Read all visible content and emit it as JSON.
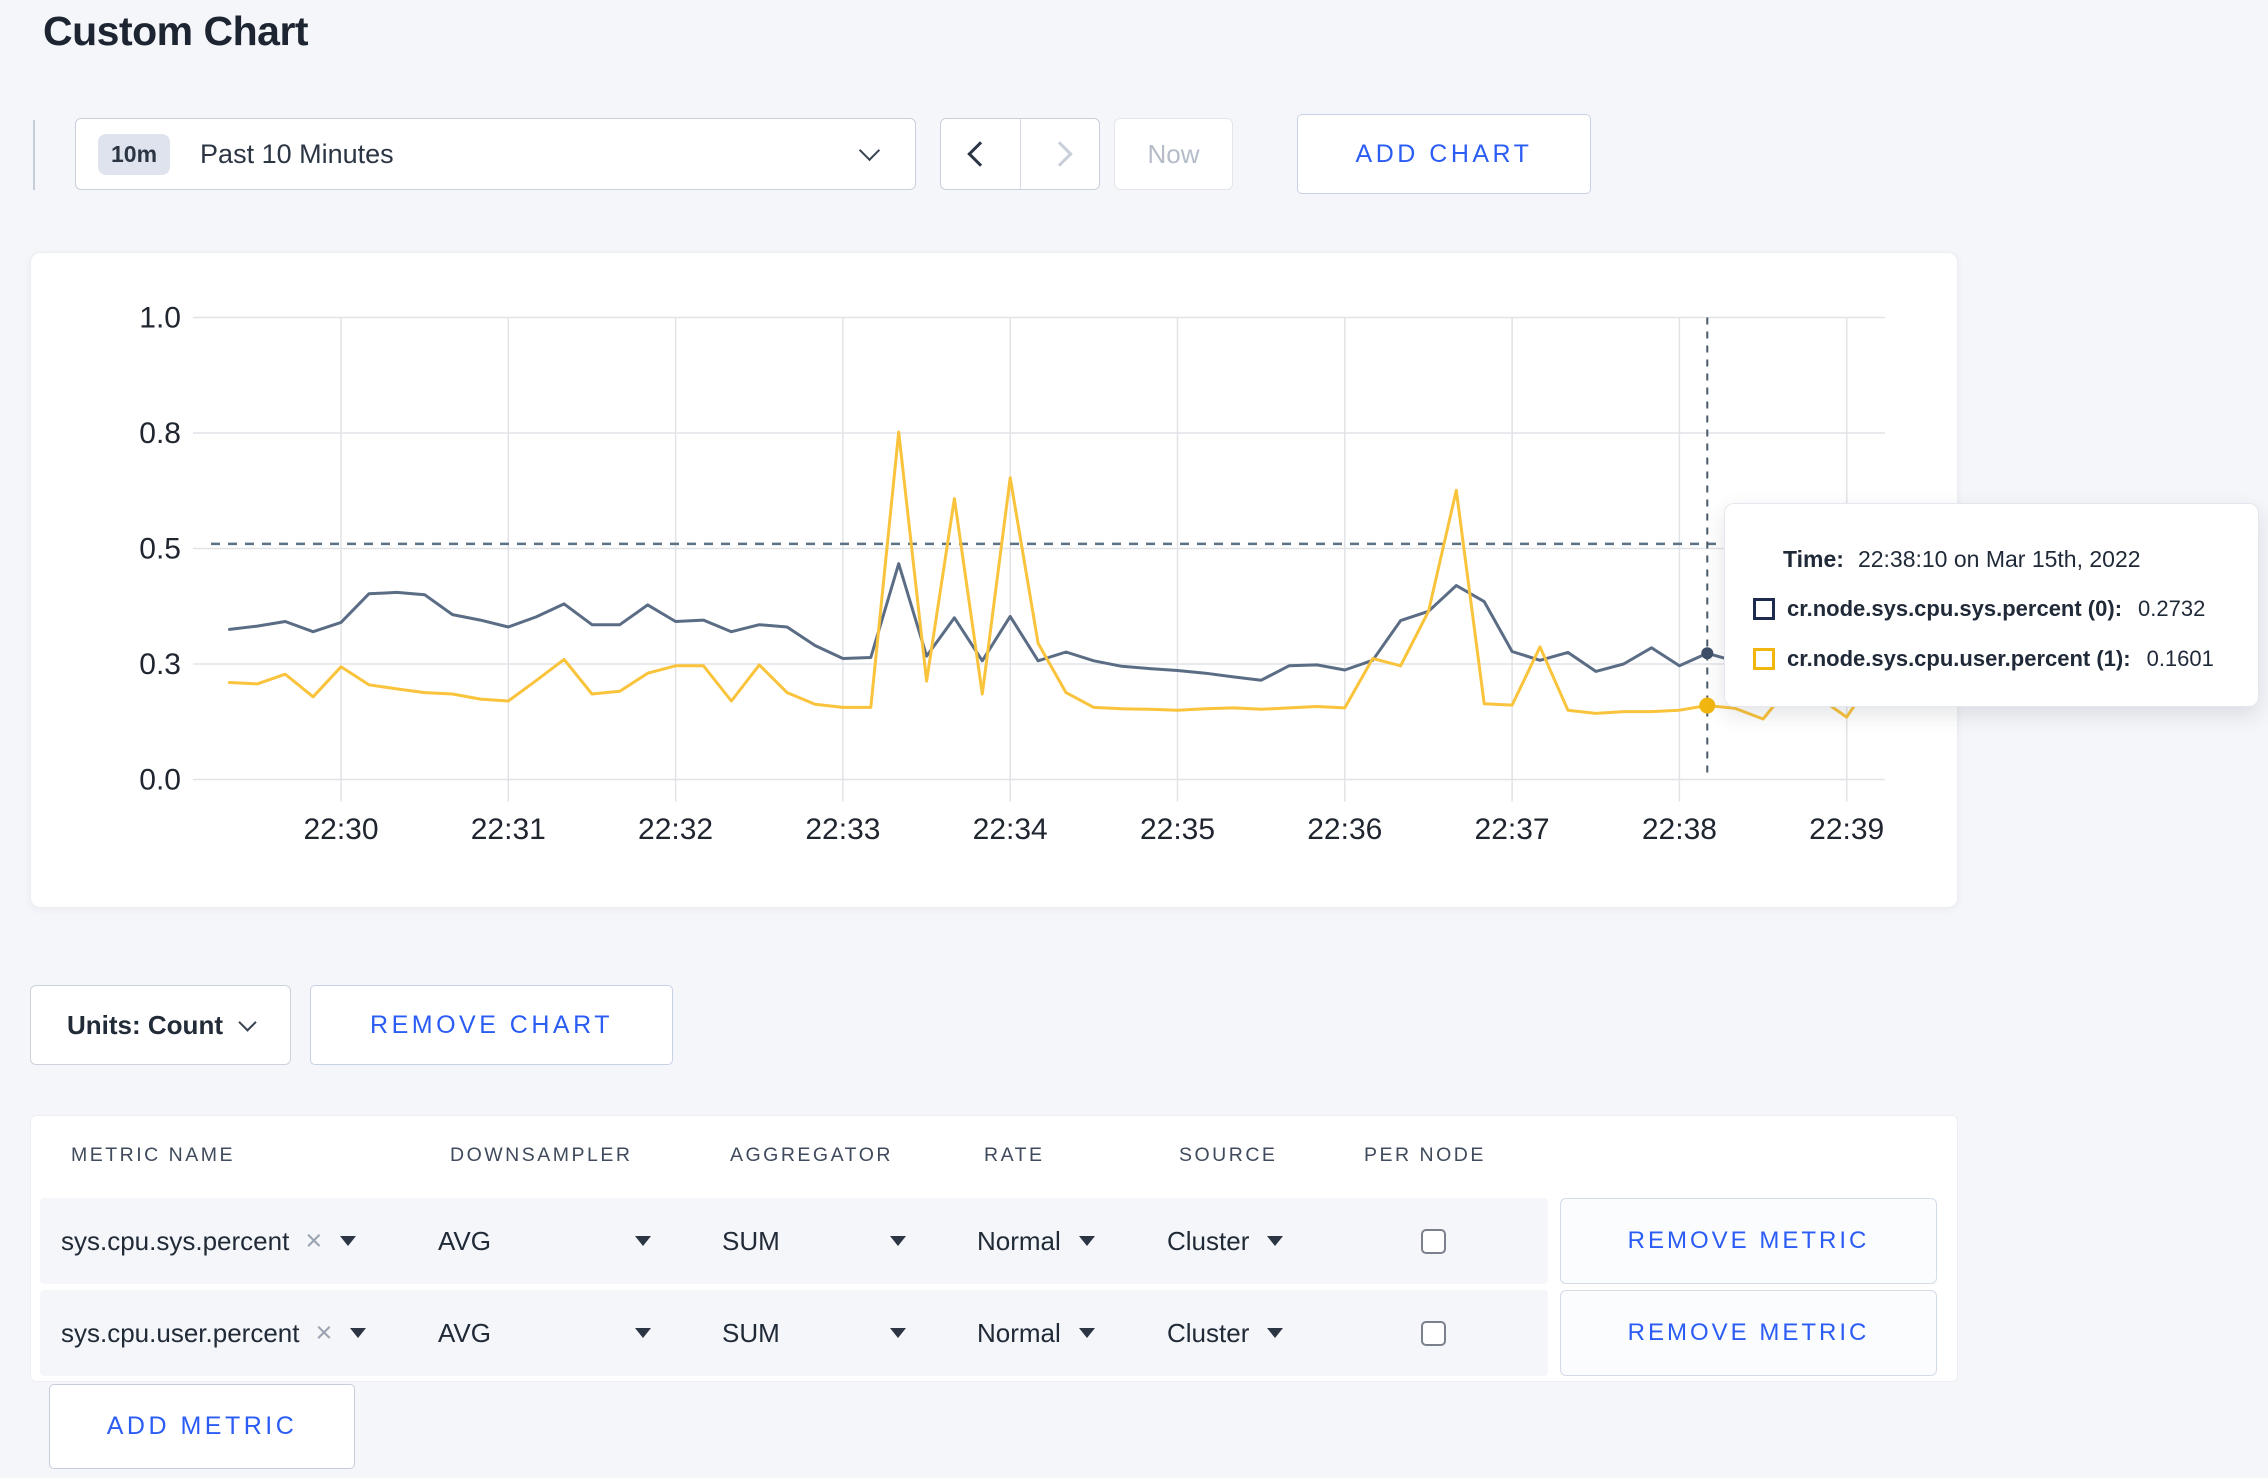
{
  "page": {
    "title": "Custom Chart"
  },
  "toolbar": {
    "time_window": {
      "badge": "10m",
      "label": "Past 10 Minutes"
    },
    "now_label": "Now",
    "add_chart_label": "ADD CHART"
  },
  "chart_data": {
    "type": "line",
    "title": "",
    "xlabel": "",
    "ylabel": "",
    "ylim": [
      0,
      1
    ],
    "grid": true,
    "legend_position": "tooltip",
    "x_ticks": [
      "22:30",
      "22:31",
      "22:32",
      "22:33",
      "22:34",
      "22:35",
      "22:36",
      "22:37",
      "22:38",
      "22:39"
    ],
    "y_ticks": [
      {
        "label": "1.0",
        "value": 1.0
      },
      {
        "label": "0.8",
        "value": 0.75
      },
      {
        "label": "0.5",
        "value": 0.5
      },
      {
        "label": "0.3",
        "value": 0.25
      },
      {
        "label": "0.0",
        "value": 0.0
      }
    ],
    "start_offset_seconds": -40,
    "step_seconds": 10,
    "guideline_value": 0.51,
    "hover": {
      "offset_seconds": 490,
      "time_label": "Time:",
      "time_value": "22:38:10 on Mar 15th, 2022"
    },
    "series": [
      {
        "name": "cr.node.sys.cpu.sys.percent (0)",
        "color": "#5b6c85",
        "swatch_color": "#1d2c4e",
        "dot_color": "#3d4f68",
        "dot_radius": 6,
        "hover": {
          "label": "cr.node.sys.cpu.sys.percent (0):",
          "value": "0.2732"
        },
        "values": [
          0.325,
          0.332,
          0.342,
          0.32,
          0.34,
          0.402,
          0.405,
          0.4,
          0.357,
          0.345,
          0.33,
          0.352,
          0.38,
          0.335,
          0.335,
          0.378,
          0.342,
          0.345,
          0.32,
          0.335,
          0.33,
          0.29,
          0.262,
          0.264,
          0.467,
          0.267,
          0.35,
          0.257,
          0.353,
          0.257,
          0.276,
          0.257,
          0.245,
          0.24,
          0.236,
          0.23,
          0.222,
          0.215,
          0.246,
          0.248,
          0.237,
          0.258,
          0.344,
          0.364,
          0.42,
          0.385,
          0.277,
          0.258,
          0.275,
          0.234,
          0.25,
          0.285,
          0.246,
          0.2732,
          0.256,
          0.262,
          0.27,
          0.255,
          0.265,
          0.272
        ]
      },
      {
        "name": "cr.node.sys.cpu.user.percent (1)",
        "color": "#f9c33c",
        "swatch_color": "#f2b70f",
        "dot_color": "#f1b60f",
        "dot_radius": 8,
        "hover": {
          "label": "cr.node.sys.cpu.user.percent (1):",
          "value": "0.1601"
        },
        "values": [
          0.21,
          0.207,
          0.228,
          0.179,
          0.244,
          0.205,
          0.196,
          0.188,
          0.185,
          0.174,
          0.17,
          0.214,
          0.26,
          0.185,
          0.191,
          0.23,
          0.246,
          0.246,
          0.17,
          0.248,
          0.188,
          0.163,
          0.156,
          0.156,
          0.752,
          0.213,
          0.608,
          0.185,
          0.653,
          0.295,
          0.188,
          0.156,
          0.153,
          0.152,
          0.15,
          0.153,
          0.155,
          0.152,
          0.155,
          0.158,
          0.155,
          0.262,
          0.246,
          0.364,
          0.626,
          0.164,
          0.161,
          0.287,
          0.15,
          0.143,
          0.147,
          0.147,
          0.15,
          0.1601,
          0.154,
          0.131,
          0.205,
          0.177,
          0.135,
          0.225
        ]
      }
    ]
  },
  "units_button": {
    "label": "Units: Count"
  },
  "remove_chart_label": "REMOVE CHART",
  "metrics_table": {
    "headers": [
      "METRIC NAME",
      "DOWNSAMPLER",
      "AGGREGATOR",
      "RATE",
      "SOURCE",
      "PER NODE"
    ],
    "rows": [
      {
        "metric": "sys.cpu.sys.percent",
        "clear": "×",
        "downsampler": "AVG",
        "aggregator": "SUM",
        "rate": "Normal",
        "source": "Cluster",
        "per_node_checked": false,
        "remove_label": "REMOVE METRIC"
      },
      {
        "metric": "sys.cpu.user.percent",
        "clear": "×",
        "downsampler": "AVG",
        "aggregator": "SUM",
        "rate": "Normal",
        "source": "Cluster",
        "per_node_checked": false,
        "remove_label": "REMOVE METRIC"
      }
    ],
    "add_metric_label": "ADD METRIC"
  }
}
